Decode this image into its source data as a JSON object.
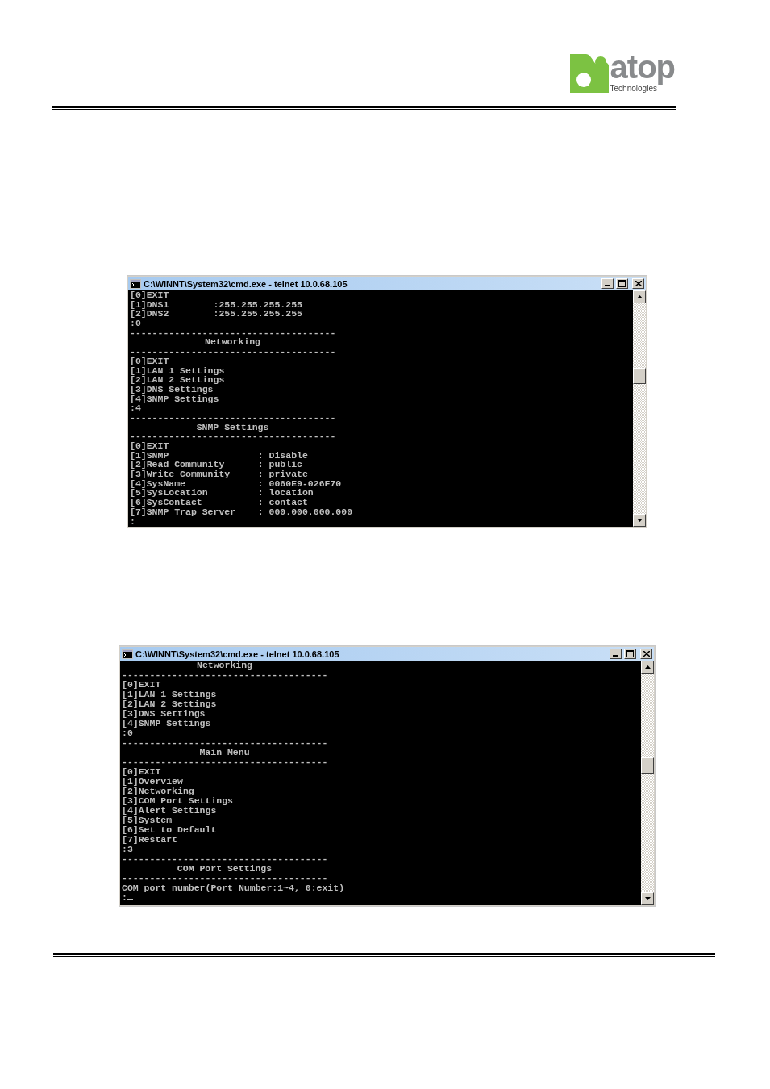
{
  "logo": {
    "wordmark": "atop",
    "tagline": "Technologies"
  },
  "windows": [
    {
      "title": "C:\\WINNT\\System32\\cmd.exe - telnet 10.0.68.105",
      "lines": [
        {
          "kind": "text",
          "text": "[0]EXIT"
        },
        {
          "kind": "text",
          "text": "[1]DNS1        :255.255.255.255"
        },
        {
          "kind": "text",
          "text": "[2]DNS2        :255.255.255.255"
        },
        {
          "kind": "text",
          "text": ":0"
        },
        {
          "kind": "rule",
          "text": "-------------------------------------"
        },
        {
          "kind": "heading",
          "text": "Networking"
        },
        {
          "kind": "rule",
          "text": "-------------------------------------"
        },
        {
          "kind": "text",
          "text": "[0]EXIT"
        },
        {
          "kind": "text",
          "text": "[1]LAN 1 Settings"
        },
        {
          "kind": "text",
          "text": "[2]LAN 2 Settings"
        },
        {
          "kind": "text",
          "text": "[3]DNS Settings"
        },
        {
          "kind": "text",
          "text": "[4]SNMP Settings"
        },
        {
          "kind": "text",
          "text": ":4"
        },
        {
          "kind": "rule",
          "text": "-------------------------------------"
        },
        {
          "kind": "heading",
          "text": "SNMP Settings"
        },
        {
          "kind": "rule",
          "text": "-------------------------------------"
        },
        {
          "kind": "text",
          "text": "[0]EXIT"
        },
        {
          "kind": "text",
          "text": "[1]SNMP                : Disable"
        },
        {
          "kind": "text",
          "text": "[2]Read Community      : public"
        },
        {
          "kind": "text",
          "text": "[3]Write Community     : private"
        },
        {
          "kind": "text",
          "text": "[4]SysName             : 0060E9-026F70"
        },
        {
          "kind": "text",
          "text": "[5]SysLocation         : location"
        },
        {
          "kind": "text",
          "text": "[6]SysContact          : contact"
        },
        {
          "kind": "text",
          "text": "[7]SNMP Trap Server    : 000.000.000.000"
        },
        {
          "kind": "text",
          "text": ":",
          "cursor": false
        }
      ]
    },
    {
      "title": "C:\\WINNT\\System32\\cmd.exe - telnet 10.0.68.105",
      "lines": [
        {
          "kind": "heading",
          "text": "Networking"
        },
        {
          "kind": "rule",
          "text": "-------------------------------------"
        },
        {
          "kind": "text",
          "text": "[0]EXIT"
        },
        {
          "kind": "text",
          "text": "[1]LAN 1 Settings"
        },
        {
          "kind": "text",
          "text": "[2]LAN 2 Settings"
        },
        {
          "kind": "text",
          "text": "[3]DNS Settings"
        },
        {
          "kind": "text",
          "text": "[4]SNMP Settings"
        },
        {
          "kind": "text",
          "text": ":0"
        },
        {
          "kind": "rule",
          "text": "-------------------------------------"
        },
        {
          "kind": "heading",
          "text": "Main Menu"
        },
        {
          "kind": "rule",
          "text": "-------------------------------------"
        },
        {
          "kind": "text",
          "text": "[0]EXIT"
        },
        {
          "kind": "text",
          "text": "[1]Overview"
        },
        {
          "kind": "text",
          "text": "[2]Networking"
        },
        {
          "kind": "text",
          "text": "[3]COM Port Settings"
        },
        {
          "kind": "text",
          "text": "[4]Alert Settings"
        },
        {
          "kind": "text",
          "text": "[5]System"
        },
        {
          "kind": "text",
          "text": "[6]Set to Default"
        },
        {
          "kind": "text",
          "text": "[7]Restart"
        },
        {
          "kind": "text",
          "text": ":3"
        },
        {
          "kind": "rule",
          "text": "-------------------------------------"
        },
        {
          "kind": "heading",
          "text": "COM Port Settings"
        },
        {
          "kind": "rule",
          "text": "-------------------------------------"
        },
        {
          "kind": "text",
          "text": "COM port number(Port Number:1~4, 0:exit)"
        },
        {
          "kind": "text",
          "text": ":",
          "cursor": true
        }
      ]
    }
  ]
}
